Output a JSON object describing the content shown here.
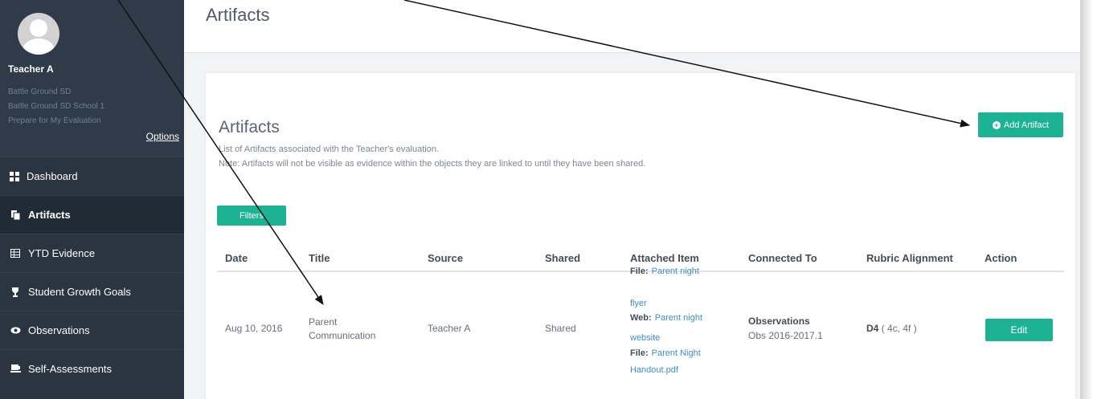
{
  "profile": {
    "name": "Teacher A",
    "district": "Battle Ground SD",
    "school": "Battle Ground SD School 1",
    "context": "Prepare for My Evaluation",
    "options_label": "Options"
  },
  "nav": {
    "items": [
      {
        "label": "Dashboard",
        "icon": "dashboard-grid-icon"
      },
      {
        "label": "Artifacts",
        "icon": "artifacts-icon",
        "active": true
      },
      {
        "label": "YTD Evidence",
        "icon": "table-icon"
      },
      {
        "label": "Student Growth Goals",
        "icon": "trophy-icon"
      },
      {
        "label": "Observations",
        "icon": "eye-icon"
      },
      {
        "label": "Self-Assessments",
        "icon": "self-assessment-icon"
      }
    ]
  },
  "header": {
    "title": "Artifacts"
  },
  "card": {
    "title": "Artifacts",
    "description": "List of Artifacts associated with the Teacher's evaluation.",
    "note": "Note: Artifacts will not be visible as evidence within the objects they are linked to until they have been shared.",
    "add_button": "Add Artifact",
    "filters_button": "Filters"
  },
  "table": {
    "columns": [
      "Date",
      "Title",
      "Source",
      "Shared",
      "Attached Item",
      "Connected To",
      "Rubric Alignment",
      "Action"
    ],
    "rows": [
      {
        "date": "Aug 10, 2016",
        "title_line1": "Parent",
        "title_line2": "Communication",
        "source": "Teacher A",
        "shared": "Shared",
        "attachments": [
          {
            "type": "File:",
            "line1": "Parent night",
            "line2": "flyer"
          },
          {
            "type": "Web:",
            "line1": "Parent night",
            "line2": "website"
          },
          {
            "type": "File:",
            "line1": "Parent Night",
            "line2": "Handout.pdf"
          }
        ],
        "connected_title": "Observations",
        "connected_sub": "Obs 2016-2017.1",
        "rubric_main": "D4",
        "rubric_detail": " ( 4c, 4f )",
        "action": "Edit"
      }
    ]
  },
  "colors": {
    "accent": "#1bb394",
    "sidebar": "#2b3541",
    "link": "#3d8fc6"
  }
}
